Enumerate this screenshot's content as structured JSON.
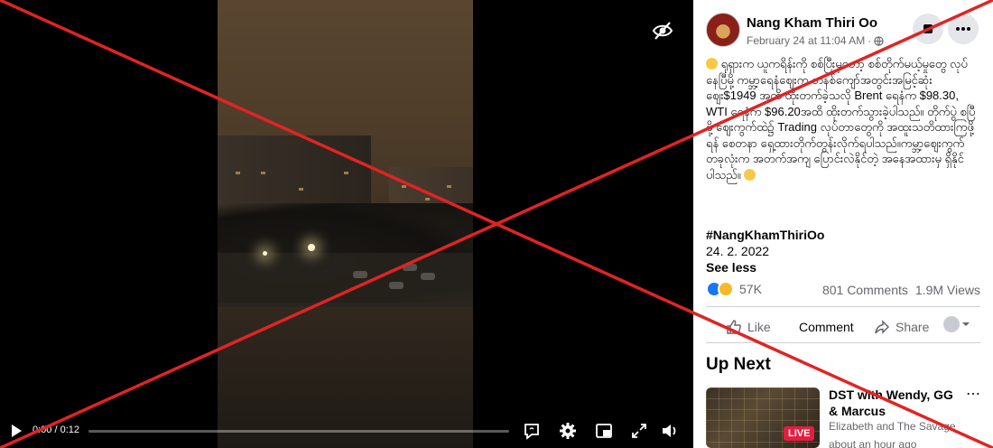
{
  "player": {
    "time_display": "0:00 / 0:12",
    "progress_fraction": 0.0,
    "hide_icon": "eye-slash-icon",
    "controls": [
      "play-icon",
      "captions-icon",
      "settings-icon",
      "picture-in-picture-icon",
      "fullscreen-icon",
      "volume-icon"
    ]
  },
  "post": {
    "author": "Nang Kham Thiri Oo",
    "date": "February 24 at 11:04 AM",
    "separator": "·",
    "body": "ရုရှားက ယူကရိန်းကို စစ်ပြီးမှတော့ စစ်တိုက်မယ့်မှုတွေ လုပ်နေပြီမို့ ကမ္ဘာ့ရေနံဈေးက တနစ်ကျော်အတွင်းအမြင့်ဆုံးဈေး$1949 အထိ ထိုးတက်ခဲ့သလို Brent ရေနံက $98.30, WTI ရေနံက $96.20အထိ ထိုးတက်သွားခဲ့ပါသည်။ တိုက်ပွဲ စပြီဖို့ ဈေးကွက်ထဲ၌ Trading လုပ်တာတွေကို အထူးသတိထားကြဖို့ရန် စေတနာ ရှေ့ထားတိုက်တွန်းလိုက်ရပါသည်။ကမ္ဘာ့ဈေးကွက် တခုလုံးက အတက်အကျ ပြောင်းလဲနိုင်တဲ့ အနေအထားမှ ရှိနိုင်ပါသည်။",
    "hashtag": "#NangKhamThiriOo",
    "date_line": "24. 2. 2022",
    "see_less": "See less",
    "reaction_count": "57K",
    "comments": "801 Comments",
    "views": "1.9M Views",
    "actions": {
      "like": "Like",
      "comment": "Comment",
      "share": "Share"
    }
  },
  "up_next": {
    "heading": "Up Next",
    "item": {
      "title": "DST with Wendy, GG & Marcus",
      "channel": "Elizabeth and The Savage",
      "time": "about an hour ago",
      "badge": "LIVE"
    }
  },
  "colors": {
    "accent": "#1877f2",
    "live": "#e41e3f",
    "cross": "#e02424"
  }
}
